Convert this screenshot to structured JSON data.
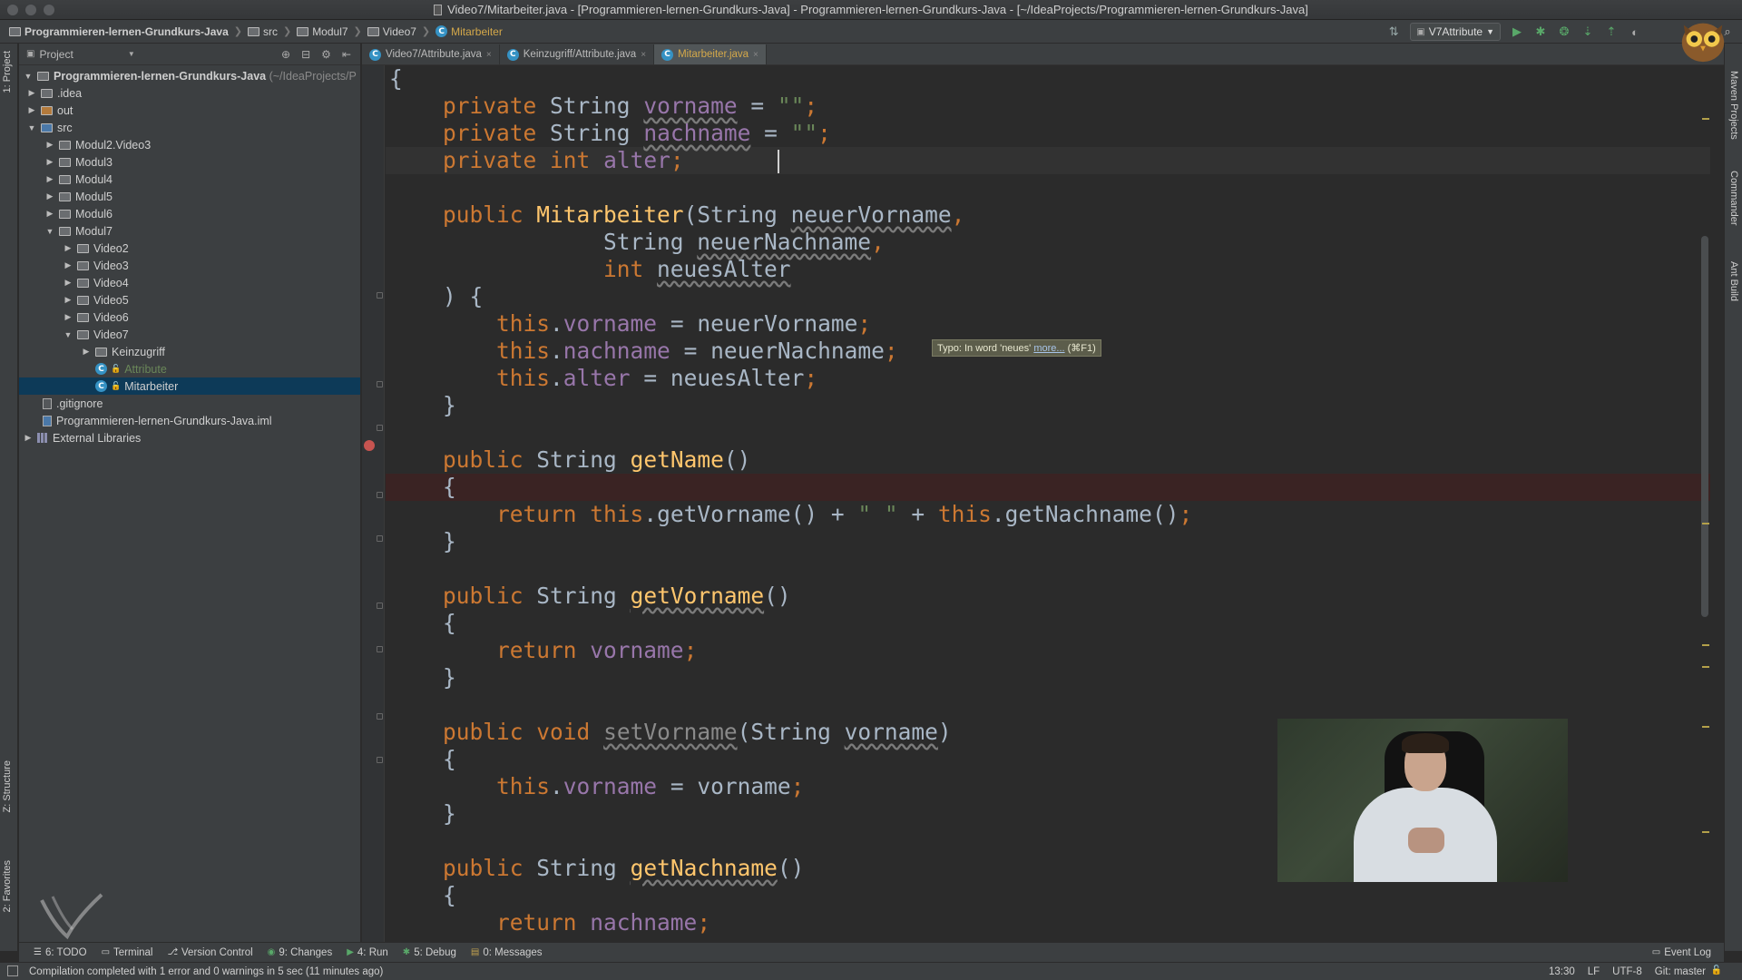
{
  "window": {
    "title": "Video7/Mitarbeiter.java - [Programmieren-lernen-Grundkurs-Java] - Programmieren-lernen-Grundkurs-Java - [~/IdeaProjects/Programmieren-lernen-Grundkurs-Java]"
  },
  "breadcrumbs": [
    {
      "label": "Programmieren-lernen-Grundkurs-Java",
      "icon": "folder-icon"
    },
    {
      "label": "src",
      "icon": "folder-icon"
    },
    {
      "label": "Modul7",
      "icon": "folder-icon"
    },
    {
      "label": "Video7",
      "icon": "folder-icon"
    },
    {
      "label": "Mitarbeiter",
      "icon": "class-icon"
    }
  ],
  "toolbar": {
    "run_config": "V7Attribute",
    "run_icon": "play-icon",
    "debug_icon": "bug-icon"
  },
  "left_strip": {
    "project_tab": "1: Project",
    "structure_tab": "Z: Structure",
    "favorites_tab": "2: Favorites"
  },
  "right_strip": {
    "maven_tab": "Maven Projects",
    "commander_tab": "Commander",
    "ant_tab": "Ant Build"
  },
  "project_panel": {
    "header": "Project",
    "root": "Programmieren-lernen-Grundkurs-Java",
    "root_path": "(~/IdeaProjects/P",
    "items": [
      {
        "label": ".idea"
      },
      {
        "label": "out"
      },
      {
        "label": "src"
      },
      {
        "label": "Modul2.Video3"
      },
      {
        "label": "Modul3"
      },
      {
        "label": "Modul4"
      },
      {
        "label": "Modul5"
      },
      {
        "label": "Modul6"
      },
      {
        "label": "Modul7"
      },
      {
        "label": "Video2"
      },
      {
        "label": "Video3"
      },
      {
        "label": "Video4"
      },
      {
        "label": "Video5"
      },
      {
        "label": "Video6"
      },
      {
        "label": "Video7"
      },
      {
        "label": "Keinzugriff"
      },
      {
        "label": "Attribute"
      },
      {
        "label": "Mitarbeiter"
      },
      {
        "label": ".gitignore"
      },
      {
        "label": "Programmieren-lernen-Grundkurs-Java.iml"
      },
      {
        "label": "External Libraries"
      }
    ]
  },
  "tabs": [
    {
      "label": "Video7/Attribute.java"
    },
    {
      "label": "Keinzugriff/Attribute.java"
    },
    {
      "label": "Mitarbeiter.java"
    }
  ],
  "editor": {
    "tooltip_text": "Typo: In word 'neues'",
    "tooltip_link": "more...",
    "tooltip_shortcut": "(⌘F1)",
    "code": {
      "l1": "{",
      "kw_private": "private",
      "kw_string": "String",
      "kw_int": "int",
      "kw_public": "public",
      "kw_void": "void",
      "kw_this": "this",
      "kw_return": "return",
      "f_vorname": "vorname",
      "f_nachname": "nachname",
      "f_alter": "alter",
      "empty_str": "\"\"",
      "space_str": "\" \"",
      "eq": " = ",
      "semi": ";",
      "ctor": "Mitarbeiter",
      "p_vorname": "neuerVorname",
      "p_nachname": "neuerNachname",
      "p_alter": "neuesAlter",
      "m_getName": "getName",
      "m_getVorname": "getVorname",
      "m_setVorname": "setVorname",
      "m_getNachname": "getNachname",
      "p_vn": "vorname"
    }
  },
  "bottom_tabs": [
    {
      "label": "6: TODO",
      "icon": "todo-icon"
    },
    {
      "label": "Terminal",
      "icon": "terminal-icon"
    },
    {
      "label": "Version Control",
      "icon": "vcs-icon"
    },
    {
      "label": "9: Changes",
      "icon": "changes-icon"
    },
    {
      "label": "4: Run",
      "icon": "play-icon"
    },
    {
      "label": "5: Debug",
      "icon": "bug-icon"
    },
    {
      "label": "0: Messages",
      "icon": "messages-icon"
    }
  ],
  "event_log": "Event Log",
  "status": {
    "message": "Compilation completed with 1 error and 0 warnings in 5 sec (11 minutes ago)",
    "position": "13:30",
    "line_sep": "LF",
    "encoding": "UTF-8",
    "git": "Git: master"
  },
  "colors": {
    "background": "#2b2b2b",
    "keyword": "#cc7832",
    "field": "#9876aa",
    "method": "#ffc66d",
    "selection": "#0d3a58"
  }
}
